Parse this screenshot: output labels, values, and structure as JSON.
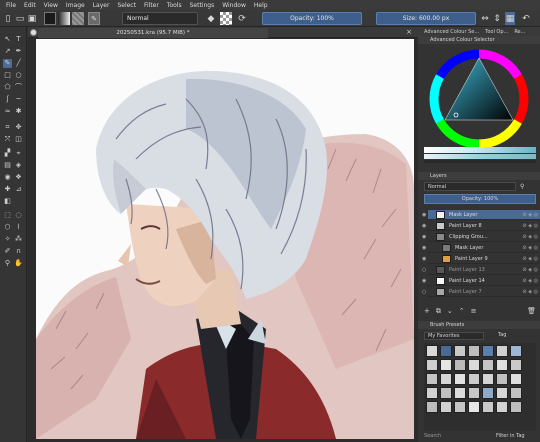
{
  "menu": [
    "File",
    "Edit",
    "View",
    "Image",
    "Layer",
    "Select",
    "Filter",
    "Tools",
    "Settings",
    "Window",
    "Help"
  ],
  "toolbar": {
    "blend_mode": "Normal",
    "opacity": "Opacity: 100%",
    "size": "Size: 600.00 px"
  },
  "document": {
    "tab_title": "20250531.kra (95.7 MiB) *"
  },
  "dock_tabs_top": [
    "Advanced Colour Se...",
    "Tool Op...",
    "Re..."
  ],
  "color_selector": {
    "title": "Advanced Colour Selector"
  },
  "layers_panel": {
    "title": "Layers",
    "blend_mode": "Normal",
    "opacity": "Opacity: 100%",
    "layers": [
      {
        "name": "Mask Layer",
        "selected": true,
        "thumb": "#f2f2f2"
      },
      {
        "name": "Paint Layer 8",
        "selected": false,
        "thumb": "#c9c9c9"
      },
      {
        "name": "Clipping Grou...",
        "selected": false,
        "thumb": "#8a8a8a"
      },
      {
        "name": "Mask Layer",
        "selected": false,
        "thumb": "#7a7a7a"
      },
      {
        "name": "Paint Layer 9",
        "selected": false,
        "thumb": "#e0a040"
      },
      {
        "name": "Paint Layer 13",
        "selected": false,
        "thumb": "#5a5a5a"
      },
      {
        "name": "Paint Layer 14",
        "selected": false,
        "thumb": "#f7f7f7"
      },
      {
        "name": "Paint Layer 7",
        "selected": false,
        "thumb": "#a8a8a8"
      }
    ]
  },
  "brush_presets": {
    "title": "Brush Presets",
    "tag": "My Favorites",
    "tag_label": "Tag",
    "search_placeholder": "Search",
    "filter_label": "Filter in Tag"
  },
  "colors": {
    "accent": "#4d6b96",
    "panel": "#333333"
  }
}
